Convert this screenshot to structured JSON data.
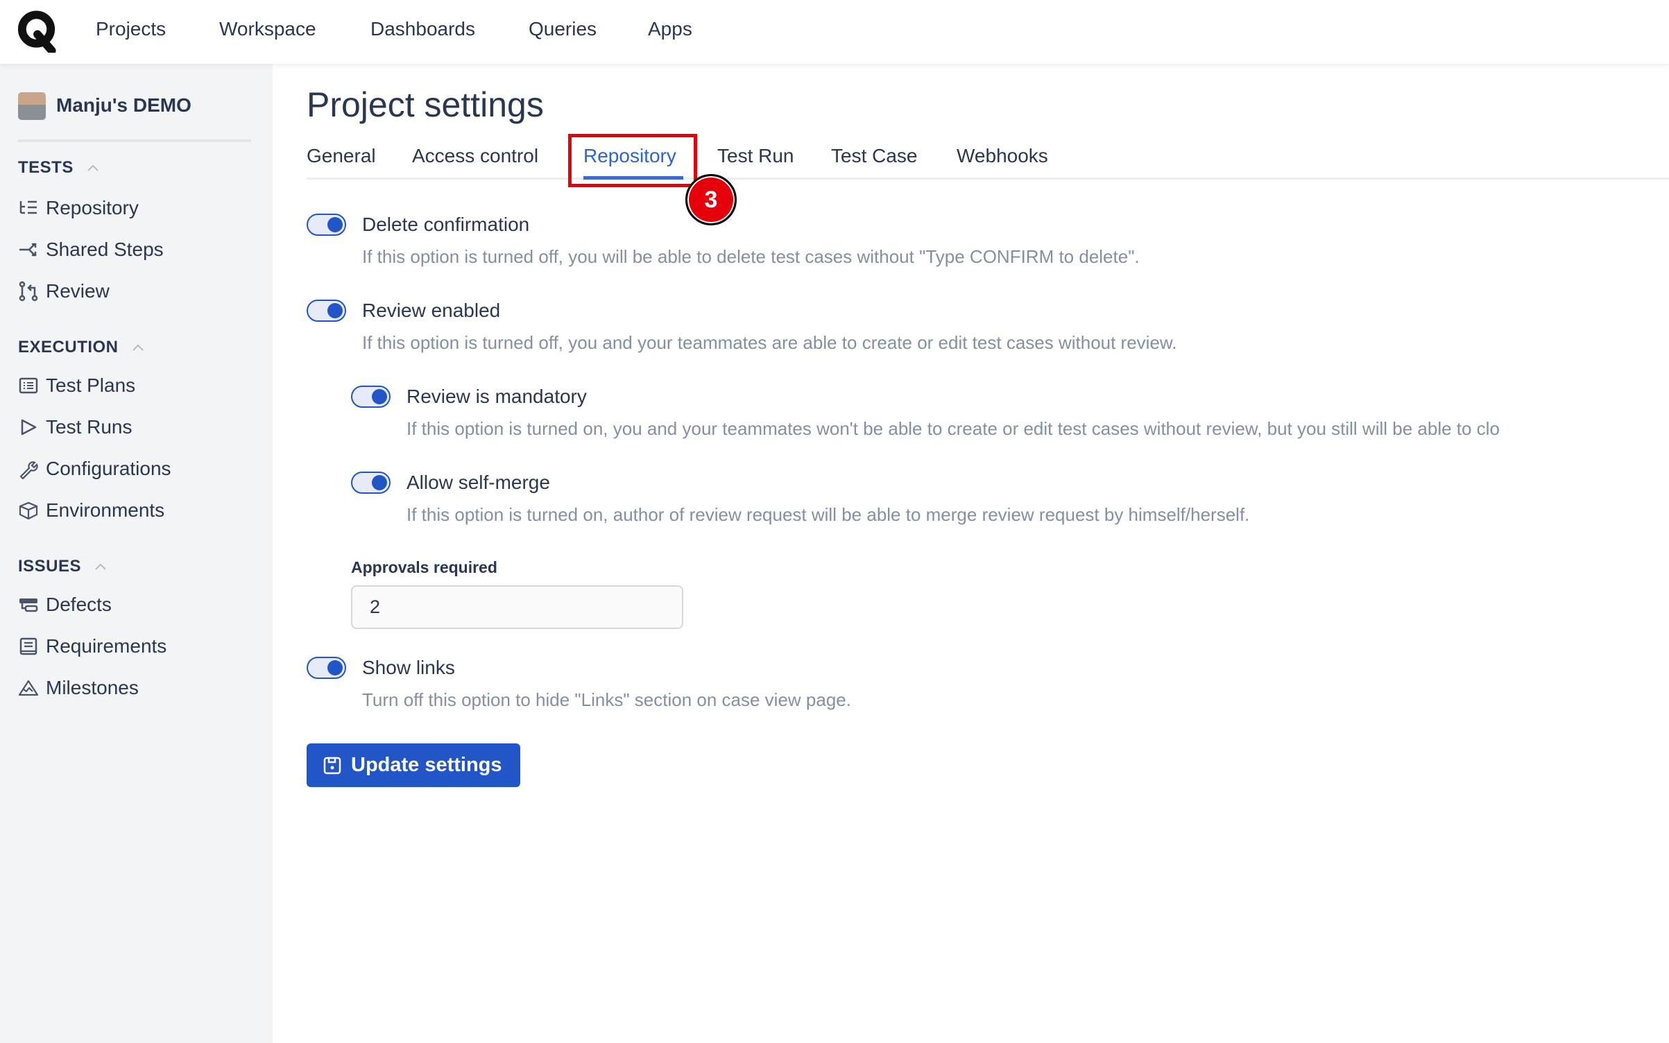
{
  "nav": {
    "logo": "Q",
    "items": [
      "Projects",
      "Workspace",
      "Dashboards",
      "Queries",
      "Apps"
    ]
  },
  "sidebar": {
    "project": "Manju's DEMO",
    "sections": [
      {
        "title": "TESTS",
        "items": [
          {
            "label": "Repository",
            "icon": "repository-tree-icon"
          },
          {
            "label": "Shared Steps",
            "icon": "shared-steps-icon"
          },
          {
            "label": "Review",
            "icon": "pull-request-icon"
          }
        ]
      },
      {
        "title": "EXECUTION",
        "items": [
          {
            "label": "Test Plans",
            "icon": "list-icon"
          },
          {
            "label": "Test Runs",
            "icon": "play-icon"
          },
          {
            "label": "Configurations",
            "icon": "wrench-icon"
          },
          {
            "label": "Environments",
            "icon": "cube-icon"
          }
        ]
      },
      {
        "title": "ISSUES",
        "items": [
          {
            "label": "Defects",
            "icon": "defects-icon"
          },
          {
            "label": "Requirements",
            "icon": "document-icon"
          },
          {
            "label": "Milestones",
            "icon": "mountain-icon"
          }
        ]
      }
    ]
  },
  "main": {
    "title": "Project settings",
    "tabs": [
      "General",
      "Access control",
      "Repository",
      "Test Run",
      "Test Case",
      "Webhooks"
    ],
    "active_tab": "Repository",
    "annotation_badge": "3",
    "settings": [
      {
        "label": "Delete confirmation",
        "desc": "If this option is turned off, you will be able to delete test cases without \"Type CONFIRM to delete\".",
        "on": true
      },
      {
        "label": "Review enabled",
        "desc": "If this option is turned off, you and your teammates are able to create or edit test cases without review.",
        "on": true
      },
      {
        "label": "Review is mandatory",
        "desc": "If this option is turned on, you and your teammates won't be able to create or edit test cases without review, but you still will be able to clo",
        "on": true
      },
      {
        "label": "Allow self-merge",
        "desc": "If this option is turned on, author of review request will be able to merge review request by himself/herself.",
        "on": true
      },
      {
        "label": "Show links",
        "desc": "Turn off this option to hide \"Links\" section on case view page.",
        "on": true
      }
    ],
    "approvals_label": "Approvals required",
    "approvals_value": "2",
    "update_button": "Update settings"
  },
  "colors": {
    "accent": "#2155c8",
    "annotation": "#e5000b",
    "sidebar_bg": "#f3f4f6"
  }
}
